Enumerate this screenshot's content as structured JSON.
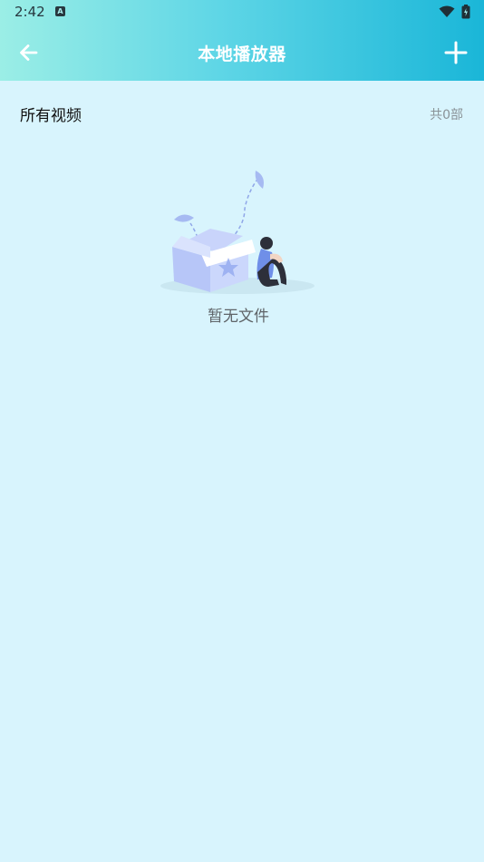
{
  "status_bar": {
    "time": "2:42",
    "notification_badge": "A",
    "icons": [
      "wifi-icon",
      "battery-icon"
    ]
  },
  "app_bar": {
    "title": "本地播放器",
    "back_icon": "arrow-left-icon",
    "add_icon": "plus-icon",
    "gradient_colors": [
      "#9beee6",
      "#1ab6d8"
    ]
  },
  "section": {
    "title": "所有视频",
    "count": "共0部"
  },
  "empty_state": {
    "illustration": "empty-box-illustration",
    "text": "暂无文件"
  },
  "colors": {
    "background": "#d8f4fd",
    "accent": "#1ab6d8"
  }
}
